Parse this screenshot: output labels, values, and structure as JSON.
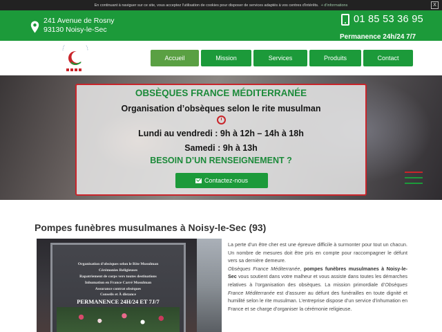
{
  "cookie": {
    "text": "En continuant à naviguer sur ce site, vous acceptez l'utilisation de cookies pour disposer de services adaptés à vos centres d'intérêts.",
    "more": "+ d'informations",
    "close": "X"
  },
  "topbar": {
    "address_line1": "241 Avenue de Rosny",
    "address_line2": "93130 Noisy-le-Sec",
    "phone": "01 85 53 36 95",
    "permanence": "Permanence 24h/24 7/7"
  },
  "nav": {
    "items": [
      {
        "label": "Accueil",
        "active": true
      },
      {
        "label": "Mission",
        "active": false
      },
      {
        "label": "Services",
        "active": false
      },
      {
        "label": "Produits",
        "active": false
      },
      {
        "label": "Contact",
        "active": false
      }
    ]
  },
  "hero": {
    "title": "OBSÈQUES FRANCE MÉDITERRANÉE",
    "subtitle": "Organisation d’obsèques selon le rite musulman",
    "hours_weekday": "Lundi au vendredi : 9h à 12h – 14h à 18h",
    "hours_saturday": "Samedi : 9h à 13h",
    "cta_heading": "BESOIN D’UN RENSEIGNEMENT ?",
    "cta_button": "Contactez-nous"
  },
  "content": {
    "title": "Pompes funèbres musulmanes à Noisy-le-Sec (93)",
    "photo_lines": [
      "Organisation d'obsèques selon le Rite Musulman",
      "Cérémonies Religieuses",
      "Rapatriement de corps vers toutes destinations",
      "Inhumation en France Carré Musulman",
      "Assurance contrat obsèques",
      "Conseils et À distance"
    ],
    "photo_permanence": "PERMANENCE 24H/24 ET 7J/7",
    "para1": "La perte d’un être cher est une épreuve difficile à surmonter pour tout un chacun. Un nombre de mesures doit être pris en compte pour raccompagner le défunt vers sa dernière demeure.",
    "para2_italic": "Obsèques France Méditerranée",
    "para2_bold": "pompes funèbres musulmanes à Noisy-le-Sec",
    "para2_rest": "vous soutient dans votre malheur et vous assiste dans toutes les démarches relatives à l’organisation des obsèques. La mission primordiale d’",
    "para2_italic2": "Obsèques France Méditerranée",
    "para2_end": "est d’assurer au défunt des funérailles en toute dignité et humilité selon le rite musulman. L’entreprise dispose d’un service d’inhumation en France et se charge d’organiser la cérémonie religieuse."
  },
  "colors": {
    "brand_green": "#1c9a3a",
    "active_green": "#5aa043",
    "accent_red": "#c9242a"
  }
}
